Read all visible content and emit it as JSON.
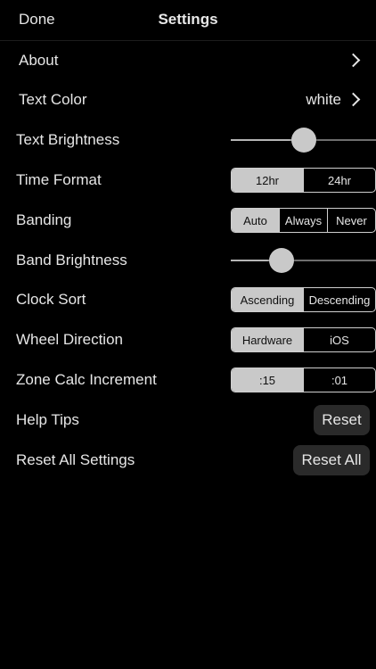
{
  "nav": {
    "done_label": "Done",
    "title": "Settings"
  },
  "rows": {
    "about": {
      "label": "About"
    },
    "text_color": {
      "label": "Text Color",
      "value": "white"
    },
    "text_brightness": {
      "label": "Text Brightness",
      "level": 0.5
    },
    "time_format": {
      "label": "Time Format",
      "options": [
        "12hr",
        "24hr"
      ],
      "selected": 0
    },
    "banding": {
      "label": "Banding",
      "options": [
        "Auto",
        "Always",
        "Never"
      ],
      "selected": 0
    },
    "band_brightness": {
      "label": "Band Brightness",
      "level": 0.35
    },
    "clock_sort": {
      "label": "Clock Sort",
      "options": [
        "Ascending",
        "Descending"
      ],
      "selected": 0
    },
    "wheel_direction": {
      "label": "Wheel Direction",
      "options": [
        "Hardware",
        "iOS"
      ],
      "selected": 0
    },
    "zone_calc": {
      "label": "Zone Calc Increment",
      "options": [
        ":15",
        ":01"
      ],
      "selected": 0
    },
    "help_tips": {
      "label": "Help Tips",
      "button": "Reset"
    },
    "reset_all": {
      "label": "Reset All Settings",
      "button": "Reset All"
    }
  },
  "colors": {
    "background": "#000000",
    "selected_segment": "#c9c9c9",
    "button_bg": "#2a2a2a"
  }
}
